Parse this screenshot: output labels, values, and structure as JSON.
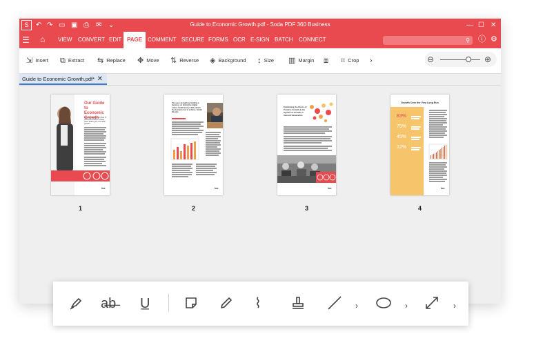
{
  "window": {
    "title": "Guide to Economic Growth.pdf - Soda PDF 360 Business",
    "app_logo": "S",
    "accent_color": "#e84a4f"
  },
  "menu": {
    "tabs": [
      "VIEW",
      "CONVERT",
      "EDIT",
      "PAGE",
      "COMMENT",
      "SECURE",
      "FORMS",
      "OCR",
      "E-SIGN",
      "BATCH",
      "CONNECT"
    ],
    "active": "PAGE"
  },
  "toolbar": {
    "insert": "Insert",
    "extract": "Extract",
    "replace": "Replace",
    "move": "Move",
    "reverse": "Reverse",
    "background": "Background",
    "size": "Size",
    "margin": "Margin",
    "crop": "Crop"
  },
  "document_tab": {
    "label": "Guide to Economic Growth.pdf*"
  },
  "pages": [
    {
      "number": "1",
      "heading": "Our Guide to Economic Growth",
      "subheading": "Why should we be critical of current economic models when looking for new GDP growth?",
      "logo": "/cc"
    },
    {
      "number": "2",
      "heading": "The open strength by building a business on distinctive digital values. Build the key skills, which the business has to achieve. Holder Results.",
      "logo": "/cc"
    },
    {
      "number": "3",
      "heading": "Explaining the Roots of Positive Growth & the Spread of Growth in Second Generation",
      "logo": "/cc"
    },
    {
      "number": "4",
      "heading": "Growth Over the Very Long Run",
      "stats": [
        "83%",
        "75%",
        "45%",
        "12%"
      ],
      "logo": "/cc"
    }
  ],
  "annotation_tools": [
    "highlight",
    "strikethrough",
    "underline",
    "sticky-note",
    "pencil",
    "attachment",
    "stamp",
    "line",
    "ellipse",
    "resize"
  ]
}
